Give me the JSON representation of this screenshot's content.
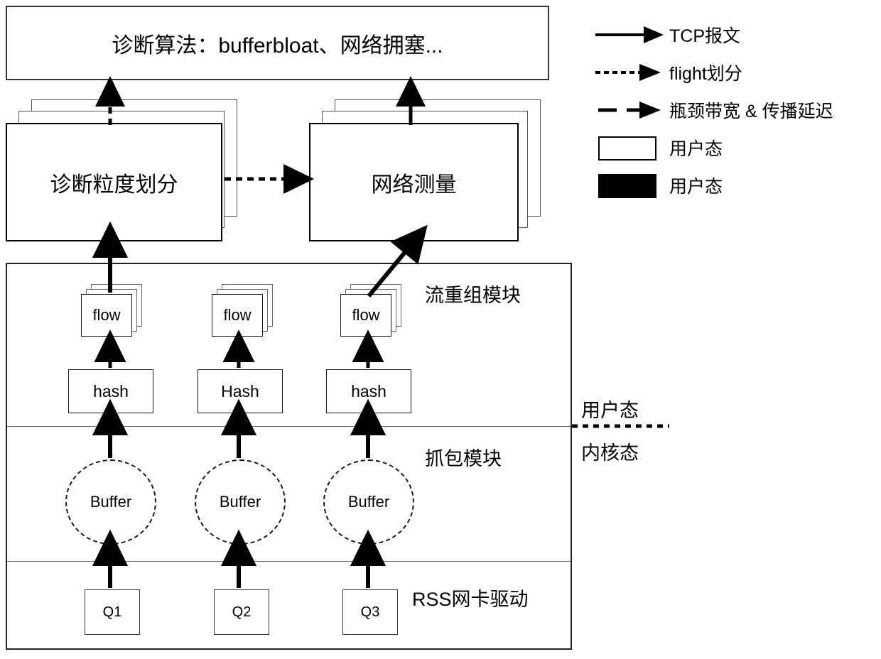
{
  "diagram": {
    "title_box": {
      "label": "诊断算法：bufferbloat、网络拥塞..."
    },
    "middle_layer": [
      {
        "label": "诊断粒度划分",
        "stack_count": 3
      },
      {
        "label": "网络测量",
        "stack_count": 3
      }
    ],
    "main_container": {
      "sections": [
        {
          "label": "流重组模块"
        },
        {
          "label": "抓包模块"
        },
        {
          "label": "RSS网卡驱动"
        }
      ],
      "columns": [
        {
          "flow": "flow",
          "hash": "hash",
          "buffer": "Buffer",
          "queue": "Q1"
        },
        {
          "flow": "flow",
          "hash": "Hash",
          "buffer": "Buffer",
          "queue": "Q2"
        },
        {
          "flow": "flow",
          "hash": "hash",
          "buffer": "Buffer",
          "queue": "Q3"
        }
      ]
    },
    "boundary": {
      "user_space": "用户态",
      "kernel_space": "内核态"
    },
    "legend": {
      "items": [
        {
          "symbol": "solid-arrow",
          "label": "TCP报文"
        },
        {
          "symbol": "dotted-arrow",
          "label": "flight划分"
        },
        {
          "symbol": "dashed-arrow",
          "label": "瓶颈带宽 & 传播延迟"
        },
        {
          "symbol": "white-swatch",
          "label": "用户态"
        },
        {
          "symbol": "black-swatch",
          "label": "用户态"
        }
      ]
    },
    "colors": {
      "stroke": "#000000",
      "background": "#ffffff",
      "thin_stroke": "#6a6a6a"
    }
  }
}
